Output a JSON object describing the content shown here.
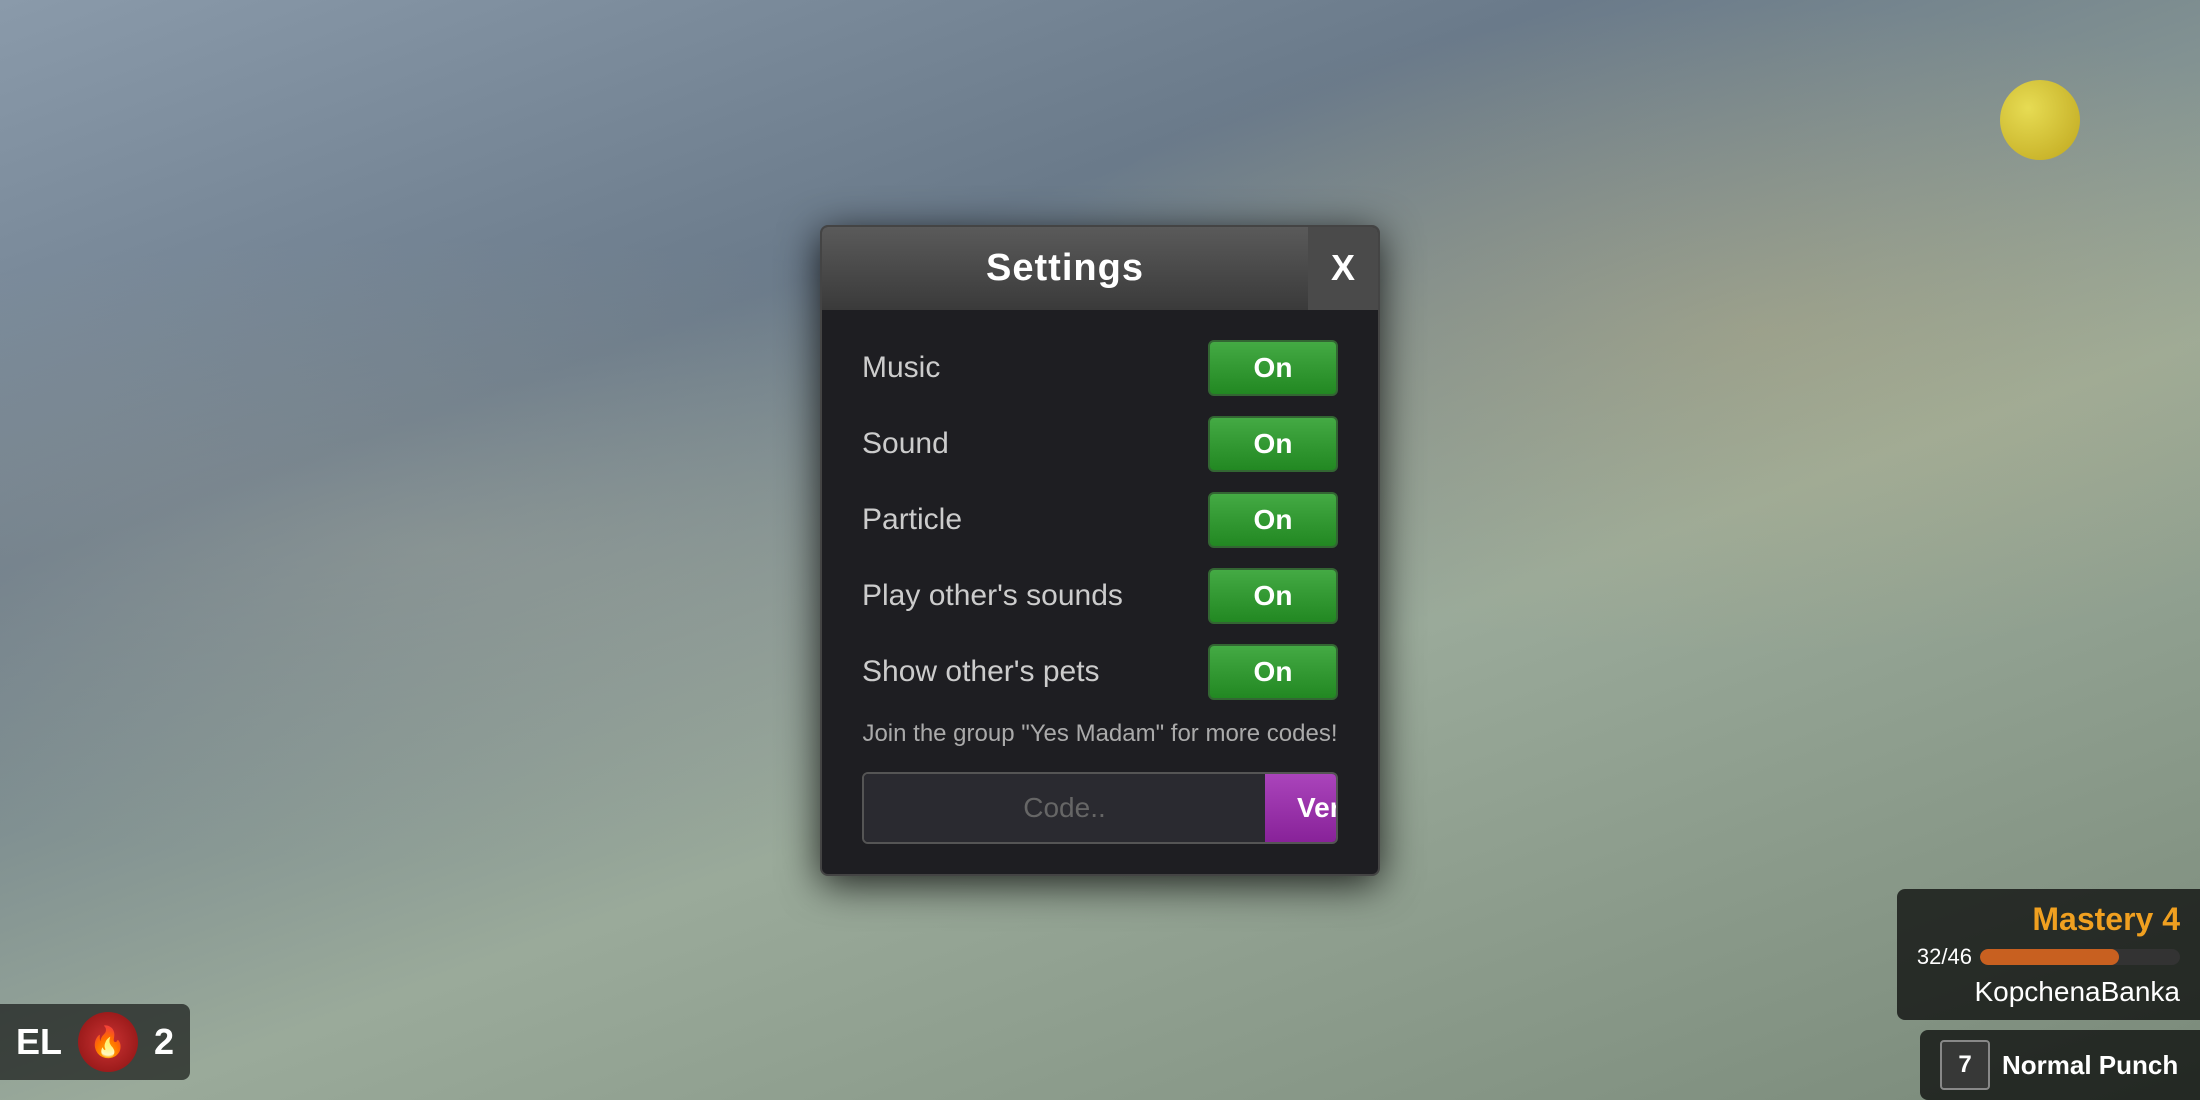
{
  "background": {
    "color": "#6a7a8a"
  },
  "modal": {
    "title": "Settings",
    "close_label": "X",
    "settings": [
      {
        "id": "music",
        "label": "Music",
        "value": "On",
        "state": true
      },
      {
        "id": "sound",
        "label": "Sound",
        "value": "On",
        "state": true
      },
      {
        "id": "particle",
        "label": "Particle",
        "value": "On",
        "state": true
      },
      {
        "id": "play-others-sounds",
        "label": "Play other's sounds",
        "value": "On",
        "state": true
      },
      {
        "id": "show-others-pets",
        "label": "Show other's pets",
        "value": "On",
        "state": true
      }
    ],
    "group_text": "Join the group \"Yes Madam\" for more codes!",
    "code_placeholder": "Code..",
    "verify_label": "Verify"
  },
  "hud": {
    "level_label": "EL",
    "currency": "171",
    "currency_count": "2",
    "mastery_title": "Mastery 4",
    "mastery_current": "32",
    "mastery_max": "46",
    "mastery_progress_pct": 69.5,
    "player_name": "KopchenaBanka",
    "ability_number": "7",
    "ability_name": "Normal Punch"
  }
}
